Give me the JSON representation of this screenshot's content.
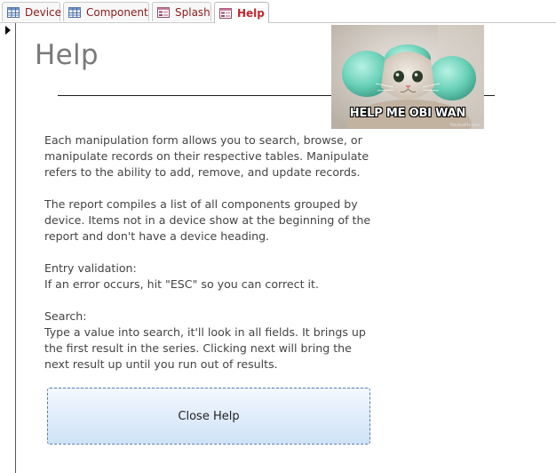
{
  "tabs": [
    {
      "label": "Device",
      "icon": "table-icon",
      "active": false
    },
    {
      "label": "Component",
      "icon": "table-icon",
      "active": false
    },
    {
      "label": "Splash",
      "icon": "form-icon",
      "active": false
    },
    {
      "label": "Help",
      "icon": "form-icon",
      "active": true
    }
  ],
  "form": {
    "title": "Help",
    "meme_caption": "HELP ME OBI WAN",
    "meme_watermark": "MadeaMemes",
    "paragraphs": [
      "Each manipulation form allows you to search, browse, or manipulate records on their respective tables.  Manipulate refers to the ability to add, remove, and update records.",
      "The report compiles a list of all components grouped by device.  Items not in a device show at the beginning of the report and don't have a device heading.",
      "Entry validation:",
      "If an error occurs, hit \"ESC\" so you can correct it.",
      "Search:",
      "Type a value into search, it'll look in all fields.  It brings up the first result in the series.  Clicking next will bring the next result up until you run out of results."
    ],
    "close_button_label": "Close Help"
  },
  "colors": {
    "tab_text": "#8b1a1a",
    "active_tab_text": "#c0282d",
    "title_text": "#7a7a7a",
    "body_text": "#444444",
    "button_gradient_top": "#f4f9ff",
    "button_gradient_bottom": "#cfe2f7"
  }
}
